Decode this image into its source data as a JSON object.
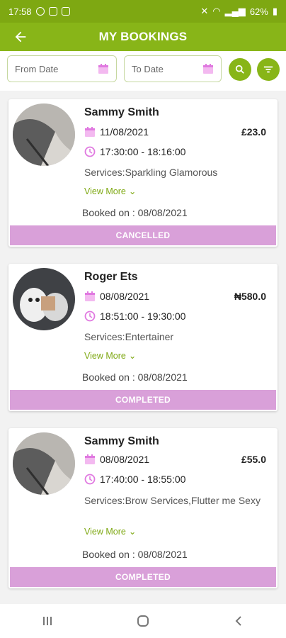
{
  "status_bar": {
    "time": "17:58",
    "battery": "62%"
  },
  "header": {
    "title": "MY BOOKINGS"
  },
  "filters": {
    "from_placeholder": "From Date",
    "to_placeholder": "To Date"
  },
  "bookings": [
    {
      "name": "Sammy  Smith",
      "date": "11/08/2021",
      "time": "17:30:00 - 18:16:00",
      "price": "£23.0",
      "services": "Services:Sparkling Glamorous",
      "view_more": "View More",
      "booked_on": "Booked on : 08/08/2021",
      "status": "CANCELLED",
      "avatar": "sammy-photo"
    },
    {
      "name": "Roger Ets",
      "date": "08/08/2021",
      "time": "18:51:00 - 19:30:00",
      "price": "₦580.0",
      "services": "Services:Entertainer",
      "view_more": "View More",
      "booked_on": "Booked on : 08/08/2021",
      "status": "COMPLETED",
      "avatar": "plush-toys-photo"
    },
    {
      "name": "Sammy  Smith",
      "date": "08/08/2021",
      "time": "17:40:00 - 18:55:00",
      "price": "£55.0",
      "services": "Services:Brow Services,Flutter me Sexy",
      "view_more": "View More",
      "booked_on": "Booked on : 08/08/2021",
      "status": "COMPLETED",
      "avatar": "sammy-photo"
    }
  ],
  "colors": {
    "brand_green": "#88b518",
    "status_purple": "#d9a0d9",
    "icon_pink": "#e079e0",
    "link_green": "#7ea812"
  }
}
